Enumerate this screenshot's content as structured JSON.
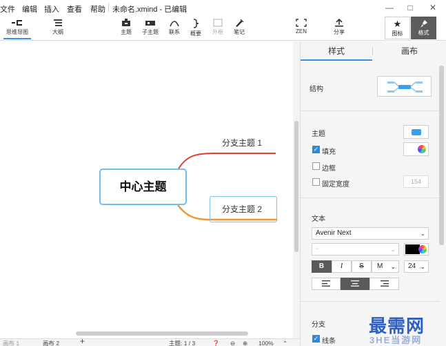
{
  "menu": {
    "items": [
      "文件",
      "编辑",
      "插入",
      "查看",
      "帮助"
    ],
    "doc_title": "未命名.xmind - 已编辑"
  },
  "toolbar": {
    "views": [
      {
        "label": "思维导图",
        "icon": "mindmap-icon",
        "active": true
      },
      {
        "label": "大纲",
        "icon": "outline-icon",
        "active": false
      }
    ],
    "tools": [
      {
        "label": "主题",
        "icon": "topic-icon",
        "disabled": false
      },
      {
        "label": "子主题",
        "icon": "subtopic-icon",
        "disabled": false
      },
      {
        "label": "联系",
        "icon": "relationship-icon",
        "disabled": false
      },
      {
        "label": "概要",
        "icon": "summary-icon",
        "disabled": false
      },
      {
        "label": "外框",
        "icon": "boundary-icon",
        "disabled": true
      },
      {
        "label": "笔记",
        "icon": "notes-icon",
        "disabled": false
      }
    ],
    "zen_label": "ZEN",
    "share_label": "分享",
    "icon_label": "图标",
    "format_label": "格式"
  },
  "canvas": {
    "central_topic": "中心主题",
    "branches": [
      "分支主题 1",
      "分支主题 2"
    ],
    "branch_colors": [
      "#e23d2f",
      "#f29431"
    ]
  },
  "statusbar": {
    "sheets": [
      "画布 1",
      "画布 2"
    ],
    "add": "+",
    "topic_count": "主题: 1 / 3",
    "zoom": "100%"
  },
  "panel": {
    "tabs": [
      "样式",
      "画布"
    ],
    "structure_label": "结构",
    "topic_label": "主题",
    "fill_label": "填充",
    "border_label": "边框",
    "fixed_width_label": "固定宽度",
    "fixed_width_value": "154",
    "text_label": "文本",
    "font_name": "Avenir Next",
    "font_weight": "-",
    "bold": "B",
    "italic": "I",
    "strike": "S",
    "case": "M",
    "font_size": "24",
    "branch_label": "分支",
    "line_label": "线条",
    "accent": "#3a8fe0"
  },
  "watermark": {
    "main": "最需网",
    "sub": "3HE当游网"
  }
}
